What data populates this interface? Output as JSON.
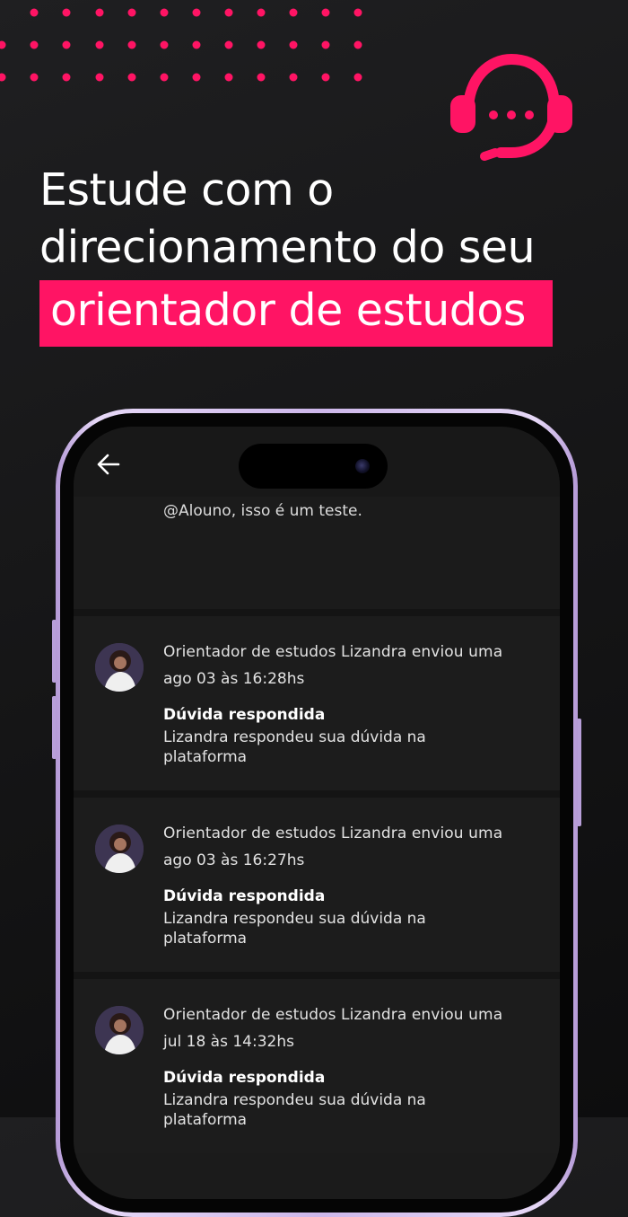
{
  "headline": {
    "line1": "Estude com o",
    "line2": "direcionamento do seu",
    "highlight": "orientador de estudos"
  },
  "colors": {
    "accent": "#ff1464",
    "background": "#161617",
    "phone_frame": "#cdb7ea"
  },
  "icons": {
    "decor": "headset-chat-icon",
    "back": "back-arrow-icon"
  },
  "app": {
    "partial_message": "@Alouno, isso é um teste.",
    "notifications": [
      {
        "title": "Orientador de estudos Lizandra enviou uma",
        "date": "ago 03 às 16:28hs",
        "heading": "Dúvida respondida",
        "body": "Lizandra respondeu sua dúvida na plataforma"
      },
      {
        "title": "Orientador de estudos Lizandra enviou uma",
        "date": "ago 03 às 16:27hs",
        "heading": "Dúvida respondida",
        "body": "Lizandra respondeu sua dúvida na plataforma"
      },
      {
        "title": "Orientador de estudos Lizandra enviou uma",
        "date": "jul 18 às 14:32hs",
        "heading": "Dúvida respondida",
        "body": "Lizandra respondeu sua dúvida na plataforma"
      }
    ]
  }
}
